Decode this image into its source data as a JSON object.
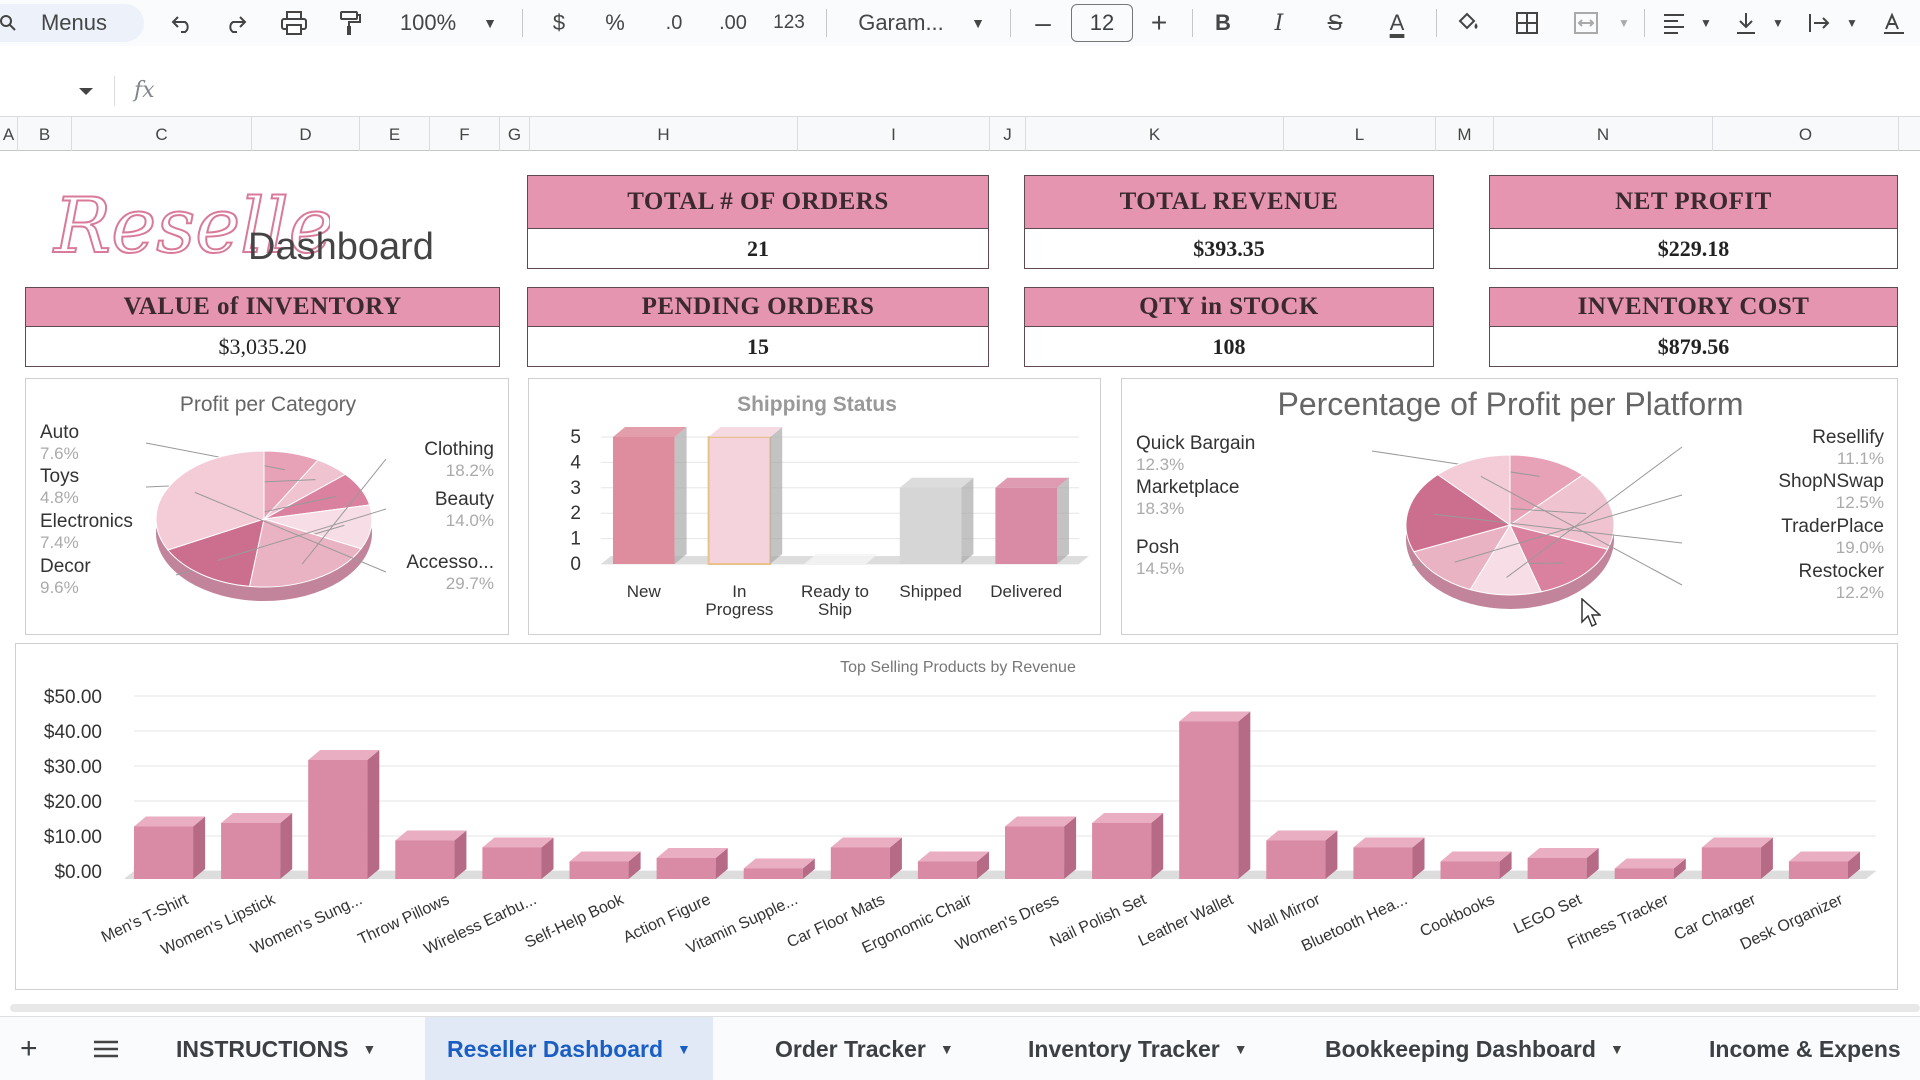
{
  "toolbar": {
    "menus_label": "Menus",
    "zoom": "100%",
    "currency": "$",
    "percent": "%",
    "decrease_decimal": ".0",
    "increase_decimal": ".00",
    "number_format": "123",
    "font": "Garam...",
    "font_size": "12",
    "minus": "–",
    "plus": "+",
    "bold": "B",
    "italic": "I",
    "strike": "S",
    "text_color": "A"
  },
  "formula_bar": {
    "fx": "fx"
  },
  "columns": [
    "A",
    "B",
    "C",
    "D",
    "E",
    "F",
    "G",
    "H",
    "I",
    "J",
    "K",
    "L",
    "M",
    "N",
    "O"
  ],
  "logo": {
    "script": "Reseller",
    "text": "Dashboard"
  },
  "kpis": [
    {
      "label": "TOTAL #  OF ORDERS",
      "value": "21"
    },
    {
      "label": "TOTAL REVENUE",
      "value": "$393.35"
    },
    {
      "label": "NET PROFIT",
      "value": "$229.18"
    },
    {
      "label": "VALUE of INVENTORY",
      "value": "$3,035.20"
    },
    {
      "label": "PENDING ORDERS",
      "value": "15"
    },
    {
      "label": "QTY in STOCK",
      "value": "108"
    },
    {
      "label": "INVENTORY COST",
      "value": "$879.56"
    }
  ],
  "colors": {
    "kpi_header": "#e695b0",
    "bar_pink": "#d98aa4",
    "accent_blue": "#1a5ec4"
  },
  "chart_data": [
    {
      "type": "pie",
      "title": "Profit per Category",
      "categories": [
        "Auto",
        "Toys",
        "Electronics",
        "Decor",
        "Clothing",
        "Beauty",
        "Accesso..."
      ],
      "values": [
        7.6,
        4.8,
        7.4,
        9.6,
        18.2,
        14.0,
        29.7
      ],
      "labels_pct": [
        "7.6%",
        "4.8%",
        "7.4%",
        "9.6%",
        "18.2%",
        "14.0%",
        "29.7%"
      ]
    },
    {
      "type": "bar",
      "title": "Shipping Status",
      "categories": [
        "New",
        "In Progress",
        "Ready to Ship",
        "Shipped",
        "Delivered"
      ],
      "values": [
        5,
        5,
        0,
        3,
        3
      ],
      "ylim": [
        0,
        5
      ],
      "yticks": [
        "5",
        "4",
        "3",
        "2",
        "1",
        "0"
      ]
    },
    {
      "type": "pie",
      "title": "Percentage of Profit per Platform",
      "categories": [
        "Quick Bargain",
        "Marketplace",
        "Posh",
        "Resellify",
        "ShopNSwap",
        "TraderPlace",
        "Restocker"
      ],
      "values": [
        12.3,
        18.3,
        14.5,
        11.1,
        12.5,
        19.0,
        12.2
      ],
      "labels_pct": [
        "12.3%",
        "18.3%",
        "14.5%",
        "11.1%",
        "12.5%",
        "19.0%",
        "12.2%"
      ]
    },
    {
      "type": "bar",
      "title": "Top Selling Products by Revenue",
      "categories": [
        "Men's T-Shirt",
        "Women's Lipstick",
        "Women's Sung...",
        "Throw Pillows",
        "Wireless Earbu...",
        "Self-Help Book",
        "Action Figure",
        "Vitamin Supple...",
        "Car Floor Mats",
        "Ergonomic Chair",
        "Women's Dress",
        "Nail Polish Set",
        "Leather Wallet",
        "Wall Mirror",
        "Bluetooth Hea...",
        "Cookbooks",
        "LEGO Set",
        "Fitness Tracker",
        "Car Charger",
        "Desk Organizer"
      ],
      "values": [
        15,
        16,
        34,
        11,
        9,
        5,
        6,
        3,
        9,
        5,
        15,
        16,
        45,
        11,
        9,
        5,
        6,
        3,
        9,
        5
      ],
      "ylim": [
        0,
        50
      ],
      "yticks": [
        "$50.00",
        "$40.00",
        "$30.00",
        "$20.00",
        "$10.00",
        "$0.00"
      ]
    }
  ],
  "tabs": [
    {
      "label": "INSTRUCTIONS"
    },
    {
      "label": "Reseller Dashboard"
    },
    {
      "label": "Order Tracker"
    },
    {
      "label": "Inventory Tracker"
    },
    {
      "label": "Bookkeeping Dashboard"
    },
    {
      "label": "Income & Expens"
    }
  ]
}
